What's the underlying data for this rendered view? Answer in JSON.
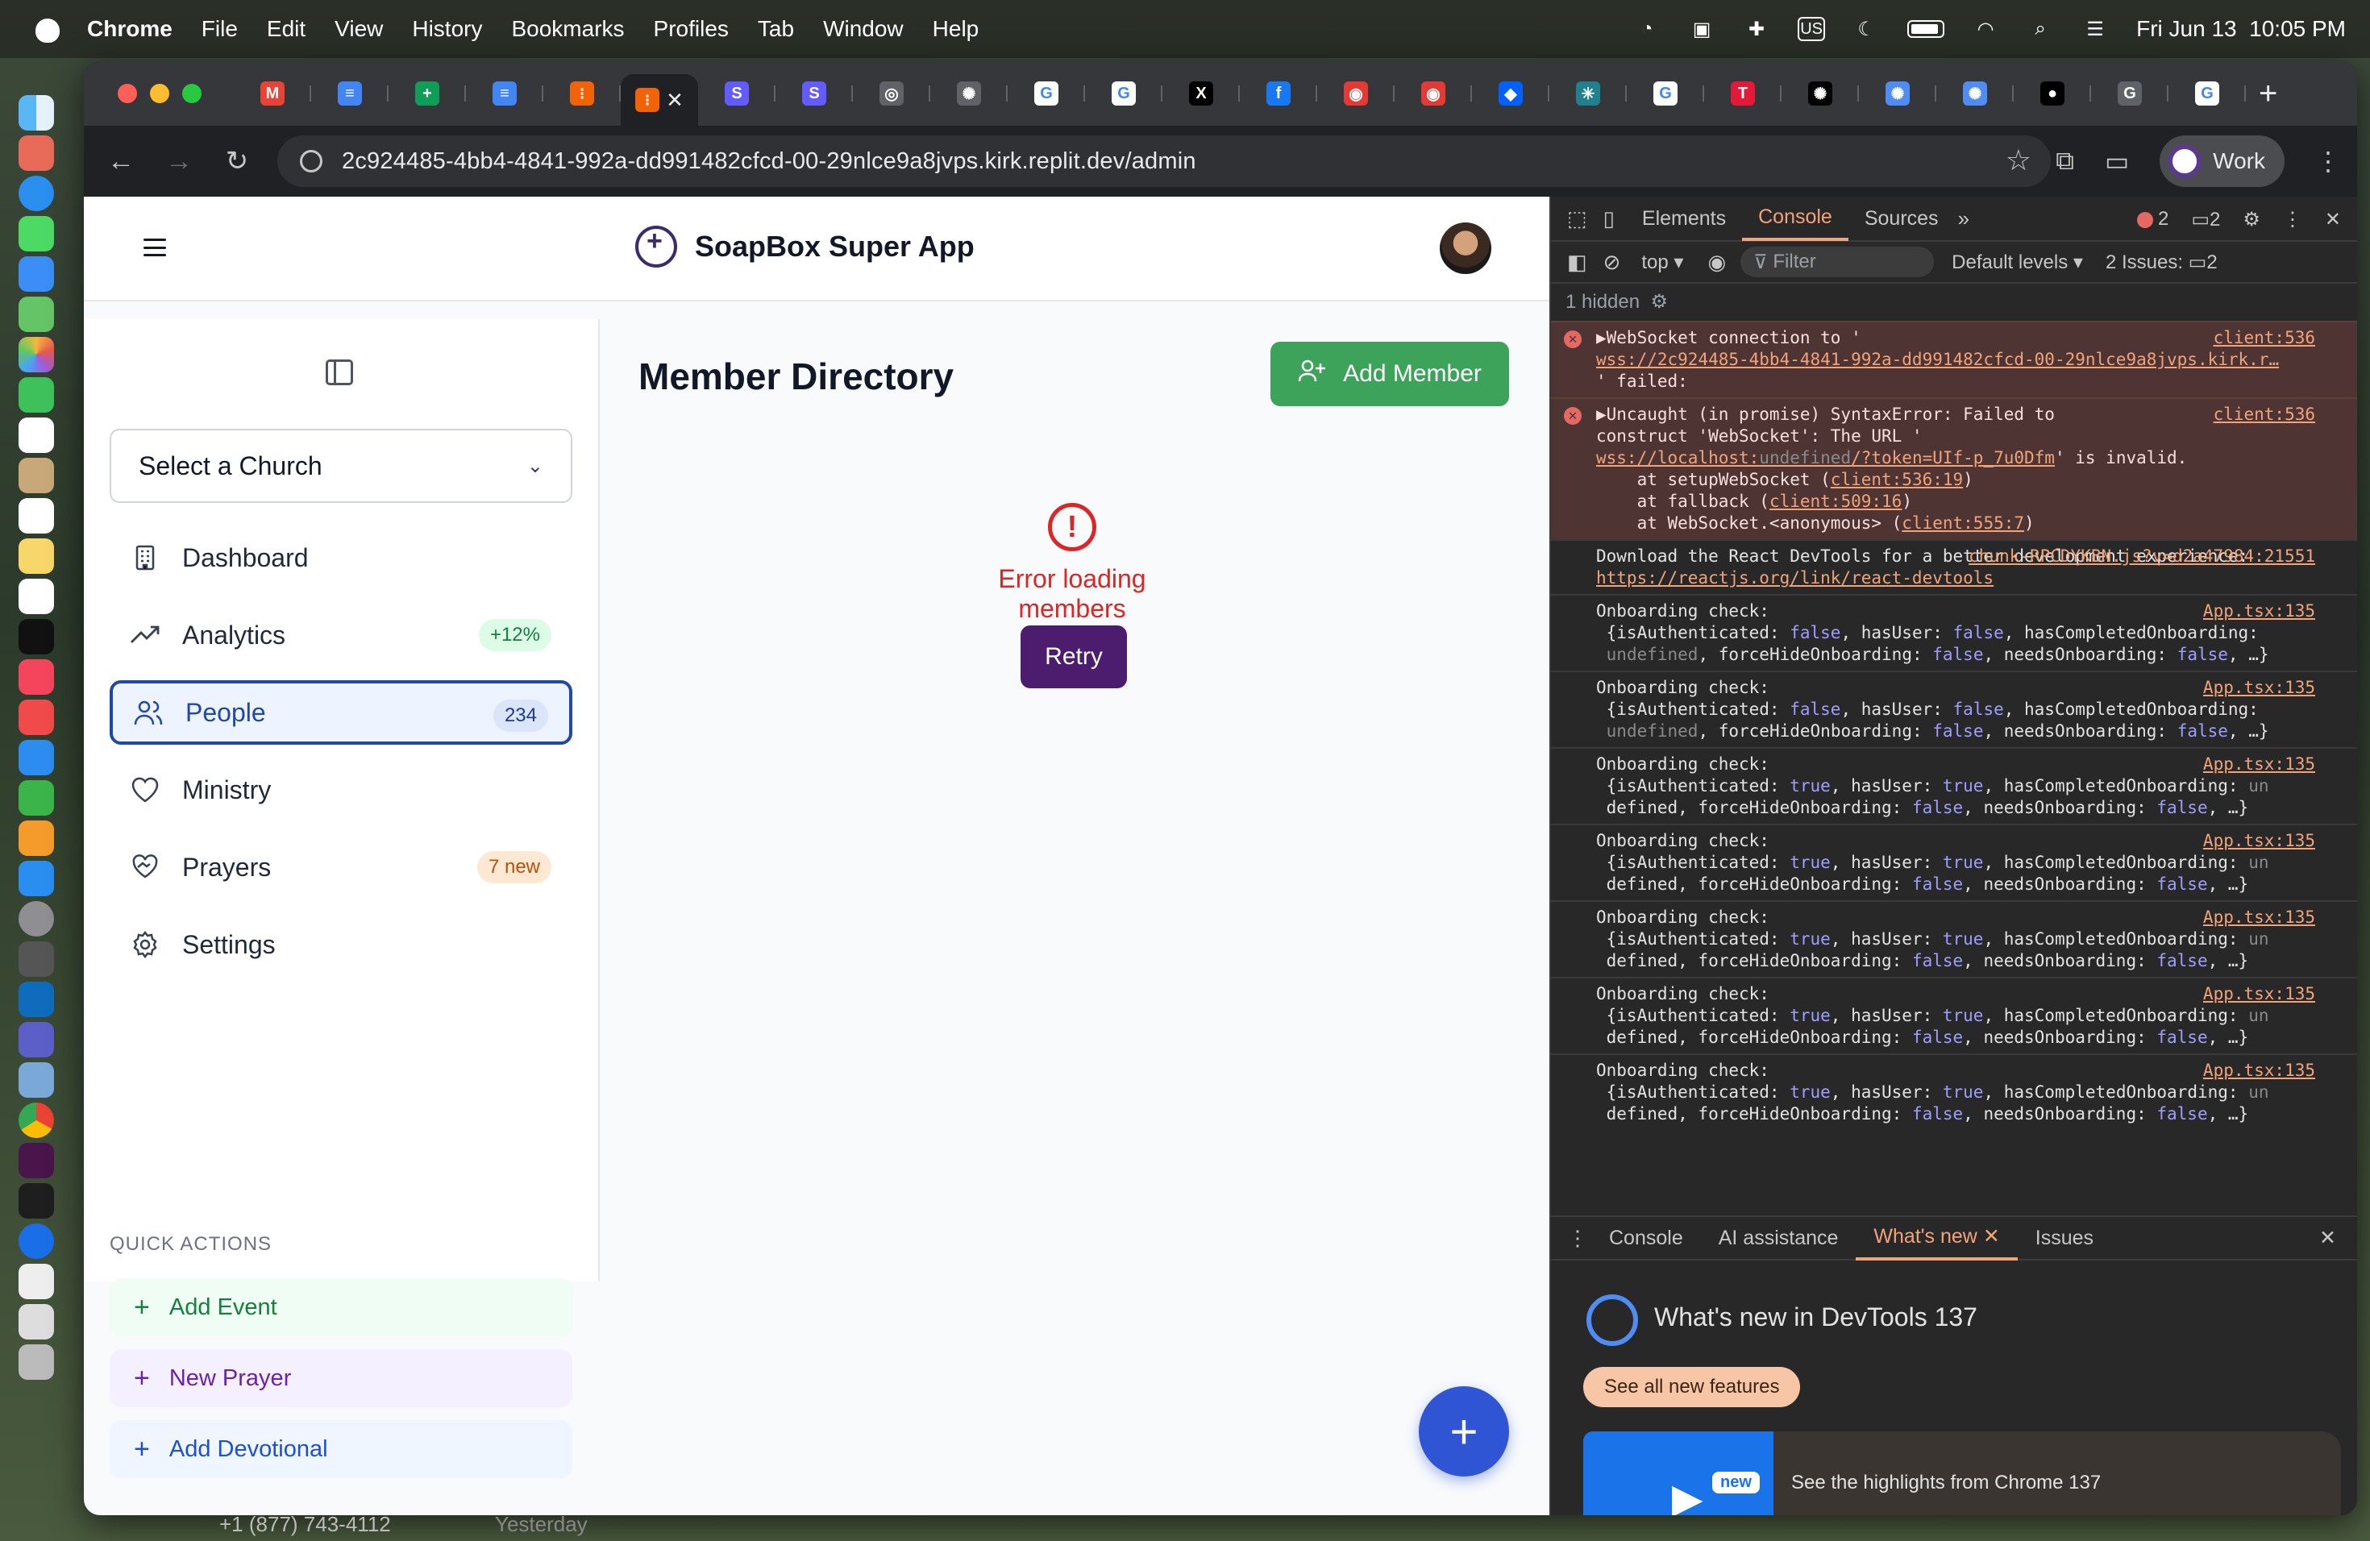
{
  "menubar": {
    "app": "Chrome",
    "items": [
      "File",
      "Edit",
      "View",
      "History",
      "Bookmarks",
      "Profiles",
      "Tab",
      "Window",
      "Help"
    ],
    "input_source": "US",
    "datetime": "Fri Jun 13  10:05 PM"
  },
  "browser": {
    "url": "2c924485-4bb4-4841-992a-dd991482cfcd-00-29nlce9a8jvps.kirk.replit.dev/admin",
    "profile": "Work",
    "tabs": [
      {
        "icon": "gmail-icon",
        "glyph": "M",
        "color": "#ea4335"
      },
      {
        "icon": "docs-icon",
        "glyph": "≡",
        "color": "#4285f4"
      },
      {
        "icon": "sheets-icon",
        "glyph": "+",
        "color": "#0f9d58"
      },
      {
        "icon": "docs-icon",
        "glyph": "≡",
        "color": "#4285f4"
      },
      {
        "icon": "replit-icon",
        "glyph": "⁝",
        "color": "#f26207"
      },
      {
        "icon": "replit-active-icon",
        "glyph": "⁝",
        "color": "#f26207",
        "active": true
      },
      {
        "icon": "stripe-icon",
        "glyph": "S",
        "color": "#635bff"
      },
      {
        "icon": "stripe-icon",
        "glyph": "S",
        "color": "#635bff"
      },
      {
        "icon": "chrome-icon",
        "glyph": "◎",
        "color": "#5f6368"
      },
      {
        "icon": "openai-icon",
        "glyph": "✺",
        "color": "#5f6368"
      },
      {
        "icon": "google-icon",
        "glyph": "G",
        "color": "#ffffff"
      },
      {
        "icon": "google-icon",
        "glyph": "G",
        "color": "#ffffff"
      },
      {
        "icon": "x-icon",
        "glyph": "X",
        "color": "#000000"
      },
      {
        "icon": "facebook-icon",
        "glyph": "f",
        "color": "#1877f2"
      },
      {
        "icon": "target-icon",
        "glyph": "◉",
        "color": "#e53935"
      },
      {
        "icon": "target-icon",
        "glyph": "◉",
        "color": "#e53935"
      },
      {
        "icon": "dropbox-icon",
        "glyph": "◆",
        "color": "#0061ff"
      },
      {
        "icon": "perplexity-icon",
        "glyph": "✳",
        "color": "#20808d"
      },
      {
        "icon": "google-icon",
        "glyph": "G",
        "color": "#ffffff"
      },
      {
        "icon": "tesla-icon",
        "glyph": "T",
        "color": "#e31937"
      },
      {
        "icon": "openai-icon",
        "glyph": "✺",
        "color": "#000000"
      },
      {
        "icon": "openai-icon",
        "glyph": "✺",
        "color": "#4f8df5"
      },
      {
        "icon": "openai-icon",
        "glyph": "✺",
        "color": "#4f8df5"
      },
      {
        "icon": "github-icon",
        "glyph": "●",
        "color": "#000000"
      },
      {
        "icon": "gemini-icon",
        "glyph": "G",
        "color": "#5f6368"
      },
      {
        "icon": "google-icon",
        "glyph": "G",
        "color": "#ffffff"
      }
    ]
  },
  "app": {
    "name": "SoapBox Super App",
    "church_select": "Select a Church",
    "nav": [
      {
        "label": "Dashboard",
        "icon": "building-icon",
        "badge": ""
      },
      {
        "label": "Analytics",
        "icon": "trending-up-icon",
        "badge": "+12%"
      },
      {
        "label": "People",
        "icon": "users-icon",
        "badge": "234",
        "active": true
      },
      {
        "label": "Ministry",
        "icon": "heart-icon",
        "badge": ""
      },
      {
        "label": "Prayers",
        "icon": "hand-heart-icon",
        "badge": "7 new"
      },
      {
        "label": "Settings",
        "icon": "gear-icon",
        "badge": ""
      }
    ],
    "quick_actions_title": "QUICK ACTIONS",
    "quick_actions": [
      "Add Event",
      "New Prayer",
      "Add Devotional"
    ],
    "page_title": "Member Directory",
    "add_member": "Add Member",
    "error_text": "Error loading members",
    "retry": "Retry"
  },
  "devtools": {
    "tabs": [
      "Elements",
      "Console",
      "Sources"
    ],
    "active_tab": "Console",
    "errors": "2",
    "warnings": "2",
    "context": "top",
    "filter_placeholder": "Filter",
    "levels": "Default levels",
    "issues": "2 Issues:",
    "issues_count": "2",
    "hidden": "1 hidden",
    "messages": [
      {
        "type": "error",
        "src": "client:536",
        "lines": [
          "▶WebSocket connection to '",
          "wss://2c924485-4bb4-4841-992a-dd991482cfcd-00-29nlce9a8jvps.kirk.r…",
          "' failed:"
        ]
      },
      {
        "type": "error",
        "src": "client:536",
        "lines": [
          "▶Uncaught (in promise) SyntaxError: Failed to",
          "construct 'WebSocket': The URL '",
          "wss://localhost:undefined/?token=UIf-p_7u0Dfm' is invalid.",
          "    at setupWebSocket (client:536:19)",
          "    at fallback (client:509:16)",
          "    at WebSocket.<anonymous> (client:555:7)"
        ]
      },
      {
        "type": "log",
        "src": "chunk-RPCDYKBN.js?v=d2a47984:21551",
        "lines": [
          "Download the React DevTools for a better development experience:",
          "https://reactjs.org/link/react-devtools"
        ]
      },
      {
        "type": "log",
        "src": "App.tsx:135",
        "lines": [
          "Onboarding check:",
          " {isAuthenticated: false, hasUser: false, hasCompletedOnboarding:",
          " undefined, forceHideOnboarding: false, needsOnboarding: false, …}"
        ]
      },
      {
        "type": "log",
        "src": "App.tsx:135",
        "lines": [
          "Onboarding check:",
          " {isAuthenticated: false, hasUser: false, hasCompletedOnboarding:",
          " undefined, forceHideOnboarding: false, needsOnboarding: false, …}"
        ]
      },
      {
        "type": "log",
        "src": "App.tsx:135",
        "lines": [
          "Onboarding check:",
          " {isAuthenticated: true, hasUser: true, hasCompletedOnboarding: un",
          " defined, forceHideOnboarding: false, needsOnboarding: false, …}"
        ]
      },
      {
        "type": "log",
        "src": "App.tsx:135",
        "lines": [
          "Onboarding check:",
          " {isAuthenticated: true, hasUser: true, hasCompletedOnboarding: un",
          " defined, forceHideOnboarding: false, needsOnboarding: false, …}"
        ]
      },
      {
        "type": "log",
        "src": "App.tsx:135",
        "lines": [
          "Onboarding check:",
          " {isAuthenticated: true, hasUser: true, hasCompletedOnboarding: un",
          " defined, forceHideOnboarding: false, needsOnboarding: false, …}"
        ]
      },
      {
        "type": "log",
        "src": "App.tsx:135",
        "lines": [
          "Onboarding check:",
          " {isAuthenticated: true, hasUser: true, hasCompletedOnboarding: un",
          " defined, forceHideOnboarding: false, needsOnboarding: false, …}"
        ]
      },
      {
        "type": "log",
        "src": "App.tsx:135",
        "lines": [
          "Onboarding check:",
          " {isAuthenticated: true, hasUser: true, hasCompletedOnboarding: un",
          " defined, forceHideOnboarding: false, needsOnboarding: false, …}"
        ]
      }
    ],
    "drawer_tabs": [
      "Console",
      "AI assistance",
      "What's new",
      "Issues"
    ],
    "drawer_active": "What's new",
    "whats_new_title": "What's new in DevTools 137",
    "see_all": "See all new features",
    "new_badge": "new",
    "highlights": "See the highlights from Chrome 137"
  },
  "background": {
    "phone": "+1 (877) 743-4112",
    "when": "Yesterday"
  }
}
